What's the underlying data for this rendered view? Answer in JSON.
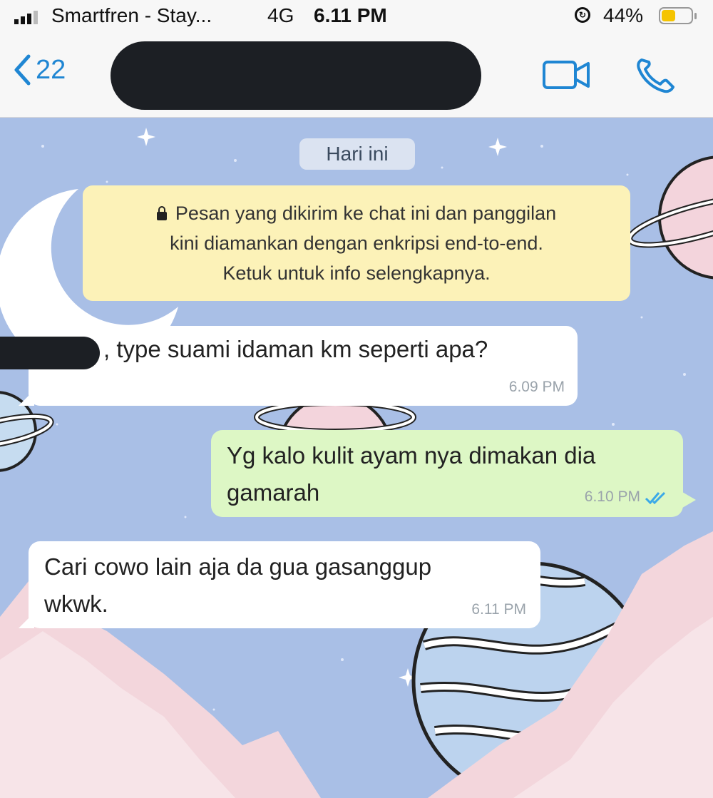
{
  "status_bar": {
    "carrier": "Smartfren - Stay...",
    "network": "4G",
    "time": "6.11 PM",
    "battery": "44%",
    "battery_level": 0.44
  },
  "nav": {
    "back_count": "22"
  },
  "chat": {
    "date_chip": "Hari ini",
    "encryption_notice": [
      "Pesan yang dikirim ke chat ini dan panggilan",
      "kini diamankan dengan enkripsi end-to-end.",
      "Ketuk untuk info selengkapnya."
    ],
    "messages": [
      {
        "direction": "incoming",
        "text": ", type suami idaman km seperti apa?",
        "time": "6.09 PM"
      },
      {
        "direction": "outgoing",
        "lines": [
          "Yg kalo kulit ayam nya dimakan dia",
          "gamarah"
        ],
        "time": "6.10 PM",
        "status": "read"
      },
      {
        "direction": "incoming",
        "lines": [
          "Cari cowo lain aja da gua gasanggup",
          "wkwk."
        ],
        "time": "6.11 PM"
      }
    ]
  },
  "colors": {
    "accent": "#1f86d3",
    "outgoing_bubble": "#ddf7c5",
    "incoming_bubble": "#ffffff",
    "notice_bubble": "#fcf2b8",
    "wallpaper": "#a9bfe6"
  }
}
